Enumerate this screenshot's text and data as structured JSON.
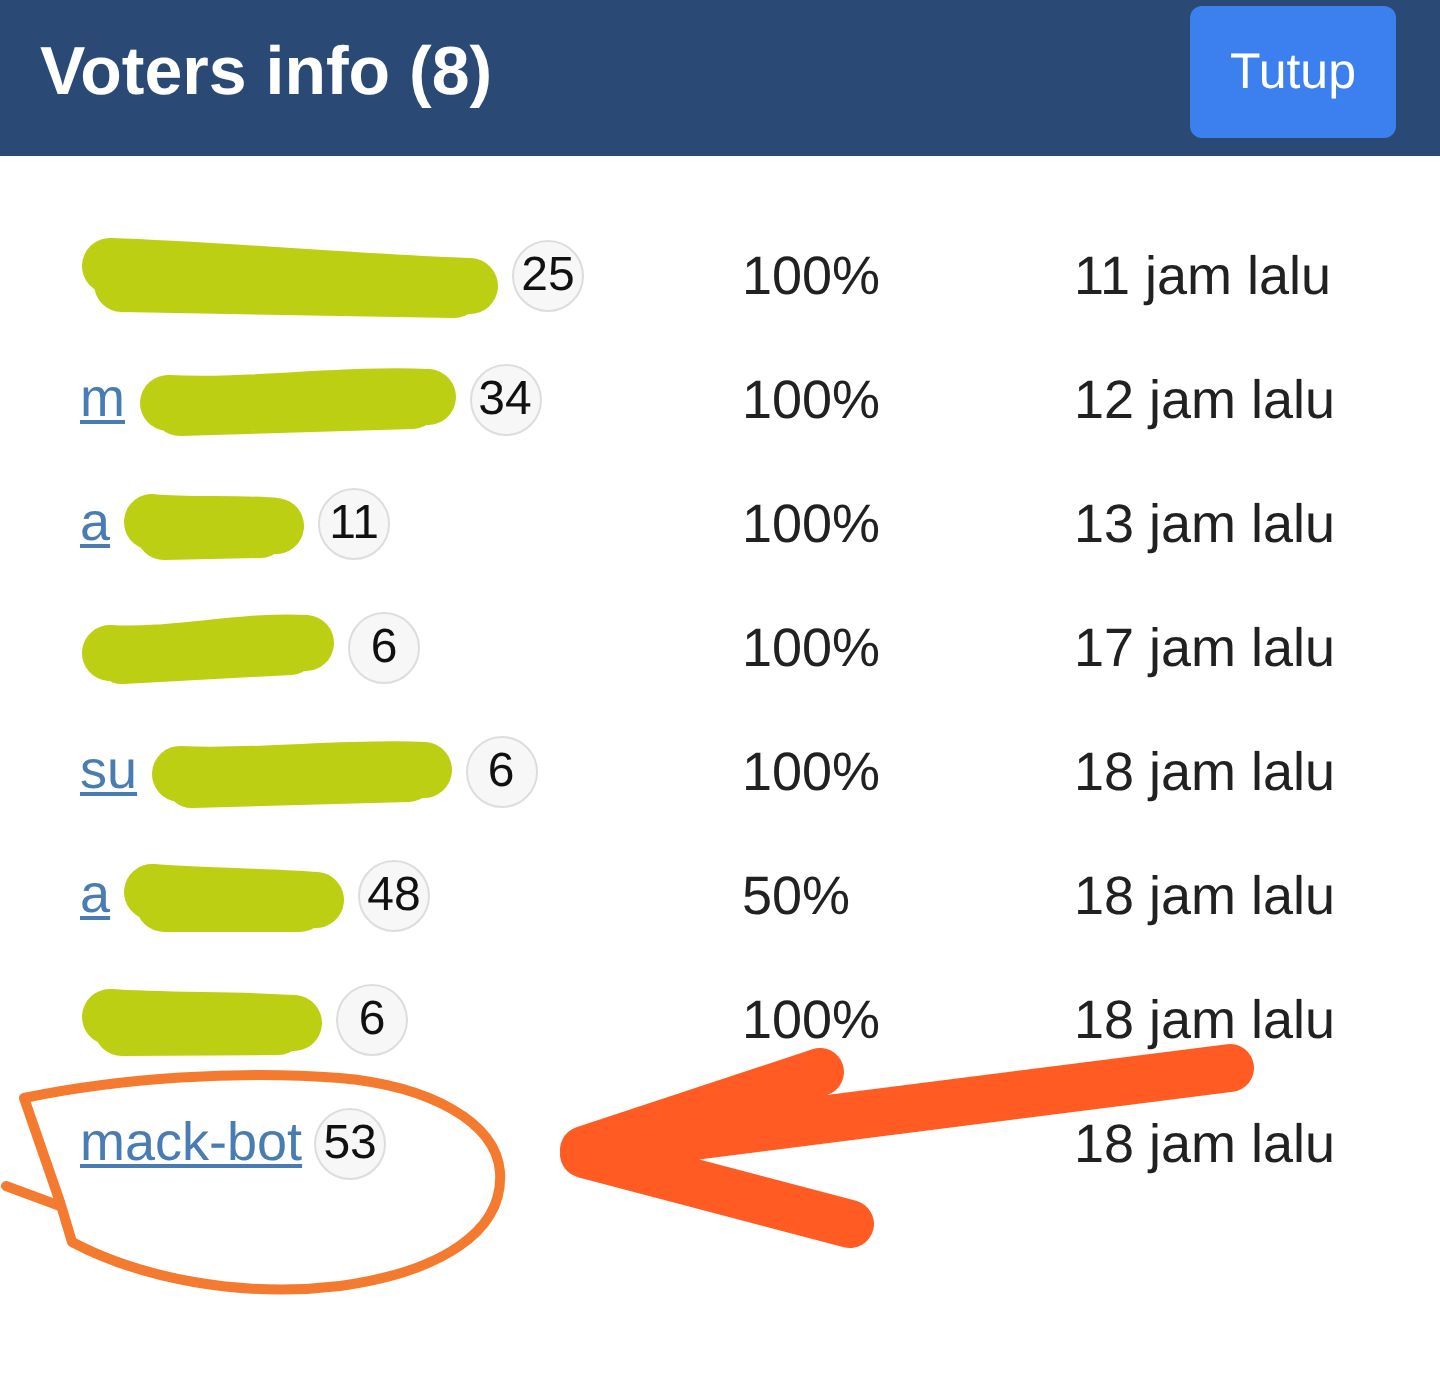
{
  "header": {
    "title": "Voters info (8)",
    "close_button": "Tutup"
  },
  "voters": [
    {
      "reputation": "25",
      "percent": "100%",
      "time": "11 jam lalu",
      "redacted": true,
      "highlighted": false
    },
    {
      "name": "m",
      "reputation": "34",
      "percent": "100%",
      "time": "12 jam lalu",
      "redacted": true,
      "highlighted": false
    },
    {
      "name": "a",
      "reputation": "11",
      "percent": "100%",
      "time": "13 jam lalu",
      "redacted": true,
      "highlighted": false
    },
    {
      "reputation": "6",
      "percent": "100%",
      "time": "17 jam lalu",
      "redacted": true,
      "highlighted": false
    },
    {
      "name": "su",
      "reputation": "6",
      "percent": "100%",
      "time": "18 jam lalu",
      "redacted": true,
      "highlighted": false
    },
    {
      "name": "a",
      "reputation": "48",
      "percent": "50%",
      "time": "18 jam lalu",
      "redacted": true,
      "highlighted": false
    },
    {
      "reputation": "6",
      "percent": "100%",
      "time": "18 jam lalu",
      "redacted": true,
      "highlighted": false
    },
    {
      "name": "mack-bot",
      "reputation": "53",
      "time": "18 jam lalu",
      "redacted": false,
      "highlighted": true
    }
  ]
}
